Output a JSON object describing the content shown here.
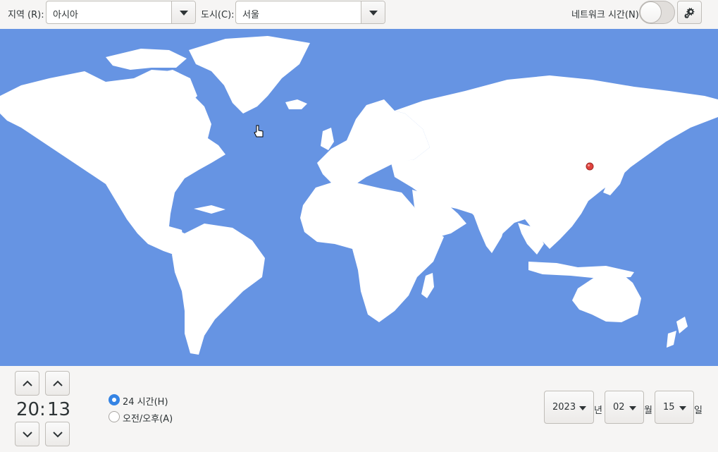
{
  "top": {
    "region_label": "지역 (R):",
    "region_value": "아시아",
    "city_label": "도시(C):",
    "city_value": "서울",
    "network_time_label": "네트워크 시간(N)",
    "network_time_on": false
  },
  "icons": {
    "gear": "gear-icon",
    "dropdown": "pan-down-icon",
    "location_pin": "map-pin-icon",
    "cursor": "hand-pointer-icon"
  },
  "colors": {
    "ocean": "#6694e3",
    "land": "#ffffff",
    "pin": "#e0433d",
    "accent": "#3584e4",
    "background": "#f6f5f4"
  },
  "time": {
    "hours": "20",
    "separator": ":",
    "minutes": "13"
  },
  "format": {
    "option_24h": "24 시간(H)",
    "option_ampm": "오전/오후(A)",
    "selected": "24h"
  },
  "date": {
    "year": "2023",
    "year_unit": "년",
    "month": "02",
    "month_unit": "월",
    "day": "15",
    "day_unit": "일"
  }
}
